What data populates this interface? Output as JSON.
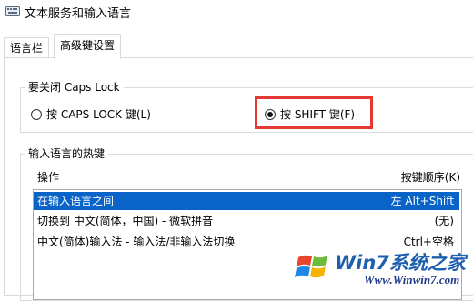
{
  "window": {
    "title": "文本服务和输入语言"
  },
  "tabs": [
    {
      "label": "语言栏"
    },
    {
      "label": "高级键设置"
    }
  ],
  "caps_group": {
    "title": "要关闭 Caps Lock",
    "options": [
      {
        "label": "按 CAPS LOCK 键(L)",
        "checked": false
      },
      {
        "label": "按 SHIFT 键(F)",
        "checked": true
      }
    ]
  },
  "hotkeys": {
    "title": "输入语言的热键",
    "col_action": "操作",
    "col_order": "按键顺序(K)",
    "rows": [
      {
        "action": "在输入语言之间",
        "keys": "左 Alt+Shift",
        "selected": true
      },
      {
        "action": "切换到 中文(简体，中国) - 微软拼音",
        "keys": "(无)",
        "selected": false
      },
      {
        "action": "中文(简体)输入法 - 输入法/非输入法切换",
        "keys": "Ctrl+空格",
        "selected": false
      }
    ]
  },
  "watermark": {
    "brand": "Win7系统之家",
    "url": "Www.Winwin7.com"
  },
  "colors": {
    "selection": "#0a64c8",
    "highlight_border": "#e53935"
  }
}
